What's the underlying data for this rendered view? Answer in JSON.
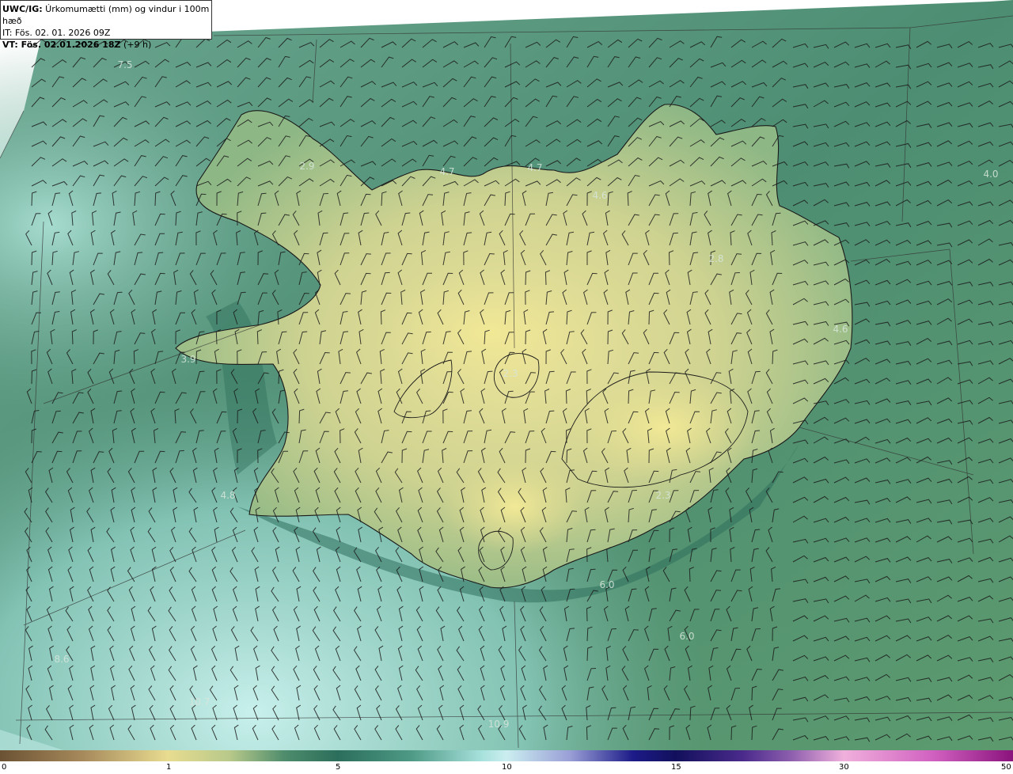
{
  "info": {
    "product_prefix": "UWC/IG:",
    "product_title": " Úrkomumætti (mm) og vindur i 100m hæð",
    "init_line": "IT: Fös. 02. 01. 2026 09Z",
    "valid_prefix": "VT: Fös. 02.01.2026 18Z",
    "valid_suffix": " (+9 h)"
  },
  "colorbar": {
    "ticks": [
      "0",
      "1",
      "5",
      "10",
      "15",
      "30",
      "50"
    ],
    "colors": [
      "#6b5233",
      "#e8dc90",
      "#2b6e5b",
      "#cbeef0",
      "#12105c",
      "#f0b0dc",
      "#8a137c"
    ]
  },
  "value_labels": [
    "7.5",
    "2.9",
    "4.7",
    "4.7",
    "4.6",
    "4.0",
    "2.8",
    "4.6",
    "3.9",
    "2.3",
    "4.8",
    "2.3",
    "6.0",
    "6.0",
    "8.6",
    "10.7",
    "10.9"
  ],
  "colors": {
    "land_yellow": "#e9e295",
    "land_green": "#9cc08c",
    "sea_green": "#4f8f72",
    "sea_dark": "#2f6f5c",
    "sea_light": "#aee0da",
    "coast": "#1a1a1a"
  }
}
